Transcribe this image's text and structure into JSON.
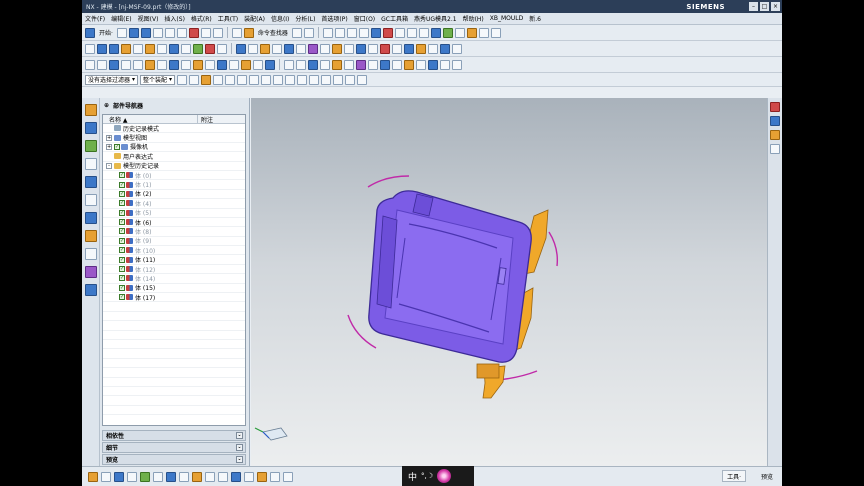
{
  "window": {
    "title": "NX - 建模 - [nj-MSF-09.prt（修改的）]",
    "brand": "SIEMENS",
    "controls": [
      "–",
      "□",
      "×"
    ]
  },
  "menubar": [
    "文件(F)",
    "编辑(E)",
    "视图(V)",
    "插入(S)",
    "格式(R)",
    "工具(T)",
    "装配(A)",
    "信息(I)",
    "分析(L)",
    "首选项(P)",
    "窗口(O)",
    "GC工具箱",
    "燕秀UG模具2.1",
    "帮助(H)",
    "XB_MOULD",
    "新.6"
  ],
  "toolbar": {
    "start_label": "开始·",
    "command_finder": "命令查找器",
    "selection_filter": "没有选择过滤器",
    "assembly_scope": "整个装配"
  },
  "navigator": {
    "title": "部件导航器",
    "col_name": "名称",
    "col_note": "附注",
    "items": [
      {
        "label": "历史记录模式",
        "level": 1,
        "icon": "history-icon",
        "checked": false,
        "dim": false,
        "expand": ""
      },
      {
        "label": "模型视图",
        "level": 1,
        "icon": "model-view-icon",
        "checked": false,
        "dim": false,
        "expand": "+"
      },
      {
        "label": "摄像机",
        "level": 1,
        "icon": "camera-icon",
        "checked": true,
        "dim": false,
        "expand": "+"
      },
      {
        "label": "用户表达式",
        "level": 1,
        "icon": "folder-icon",
        "checked": false,
        "dim": false,
        "expand": ""
      },
      {
        "label": "模型历史记录",
        "level": 1,
        "icon": "folder-icon",
        "checked": false,
        "dim": false,
        "expand": "-"
      },
      {
        "label": "体 (0)",
        "level": 2,
        "icon": "body-icon",
        "checked": true,
        "dim": true,
        "expand": ""
      },
      {
        "label": "体 (1)",
        "level": 2,
        "icon": "body-icon",
        "checked": true,
        "dim": true,
        "expand": ""
      },
      {
        "label": "体 (2)",
        "level": 2,
        "icon": "body-icon",
        "checked": true,
        "dim": false,
        "expand": ""
      },
      {
        "label": "体 (4)",
        "level": 2,
        "icon": "body-icon",
        "checked": true,
        "dim": true,
        "expand": ""
      },
      {
        "label": "体 (5)",
        "level": 2,
        "icon": "body-icon",
        "checked": true,
        "dim": true,
        "expand": ""
      },
      {
        "label": "体 (6)",
        "level": 2,
        "icon": "body-icon",
        "checked": true,
        "dim": false,
        "expand": ""
      },
      {
        "label": "体 (8)",
        "level": 2,
        "icon": "body-icon",
        "checked": true,
        "dim": true,
        "expand": ""
      },
      {
        "label": "体 (9)",
        "level": 2,
        "icon": "body-icon",
        "checked": true,
        "dim": true,
        "expand": ""
      },
      {
        "label": "体 (10)",
        "level": 2,
        "icon": "body-icon",
        "checked": true,
        "dim": true,
        "expand": ""
      },
      {
        "label": "体 (11)",
        "level": 2,
        "icon": "body-icon",
        "checked": true,
        "dim": false,
        "expand": ""
      },
      {
        "label": "体 (12)",
        "level": 2,
        "icon": "body-icon",
        "checked": true,
        "dim": true,
        "expand": ""
      },
      {
        "label": "体 (14)",
        "level": 2,
        "icon": "body-icon",
        "checked": true,
        "dim": true,
        "expand": ""
      },
      {
        "label": "体 (15)",
        "level": 2,
        "icon": "body-icon",
        "checked": true,
        "dim": false,
        "expand": ""
      },
      {
        "label": "体 (17)",
        "level": 2,
        "icon": "body-icon",
        "checked": true,
        "dim": false,
        "expand": ""
      }
    ],
    "panels": [
      "相依性",
      "细节",
      "预览"
    ]
  },
  "statusbar": {
    "ime_char": "中",
    "ime_symbols": "°,☽",
    "tools_label": "工具·",
    "preview_label": "预览"
  },
  "colors": {
    "part_body": "#7c5ce6",
    "part_edge": "#3d2a98",
    "inserts": "#f0a82a",
    "arcs": "#c02aa8"
  }
}
